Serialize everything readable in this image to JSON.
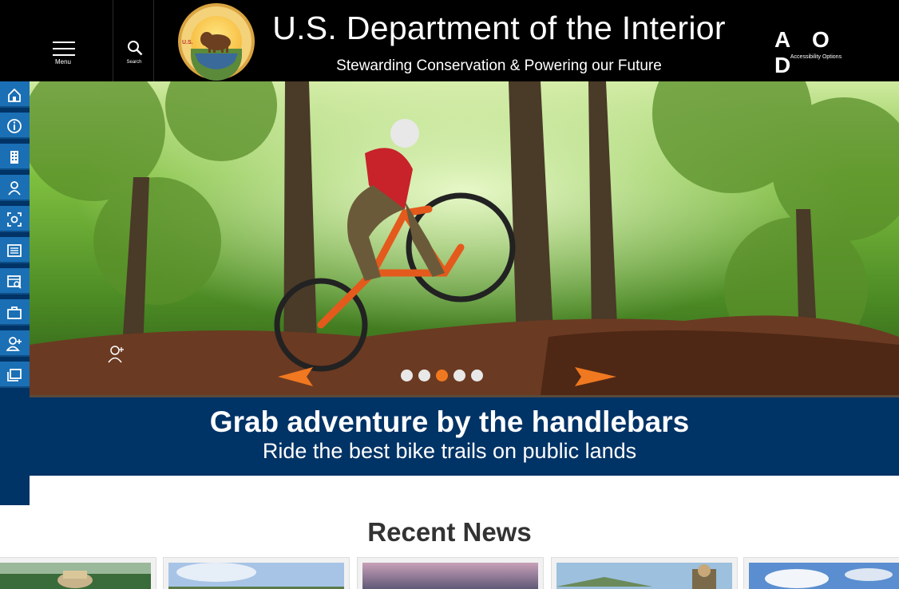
{
  "header": {
    "menu_label": "Menu",
    "search_label": "Search",
    "seal_text_top": "DEPARTMENT OF THE INTERIOR",
    "seal_text_bottom": "MARCH 3, 1849",
    "seal_letters": "U.S.",
    "title": "U.S. Department of the Interior",
    "subtitle": "Stewarding Conservation & Powering our Future",
    "accessibility_glyphs": "A O D",
    "accessibility_label": "Accessibility Options"
  },
  "sidenav": {
    "items": [
      {
        "icon": "home-icon"
      },
      {
        "icon": "info-icon"
      },
      {
        "icon": "building-icon"
      },
      {
        "icon": "people-icon"
      },
      {
        "icon": "focus-icon"
      },
      {
        "icon": "news-icon"
      },
      {
        "icon": "web-search-icon"
      },
      {
        "icon": "briefcase-icon"
      },
      {
        "icon": "add-user-icon"
      },
      {
        "icon": "gallery-icon"
      }
    ]
  },
  "carousel": {
    "slide_count": 5,
    "active_slide": 3,
    "title": "Grab adventure by the handlebars",
    "subtitle": "Ride the best bike trails on public lands",
    "arrow_color": "#f07820"
  },
  "news": {
    "heading": "Recent News",
    "cards": [
      {
        "thumb": "photo-person-in-hat"
      },
      {
        "thumb": "photo-landscape-sky"
      },
      {
        "thumb": "photo-sunset"
      },
      {
        "thumb": "photo-ranger"
      },
      {
        "thumb": "photo-clouds"
      }
    ]
  },
  "colors": {
    "brand_navy": "#003366",
    "nav_blue": "#1b6fb5",
    "accent_orange": "#f07820"
  }
}
